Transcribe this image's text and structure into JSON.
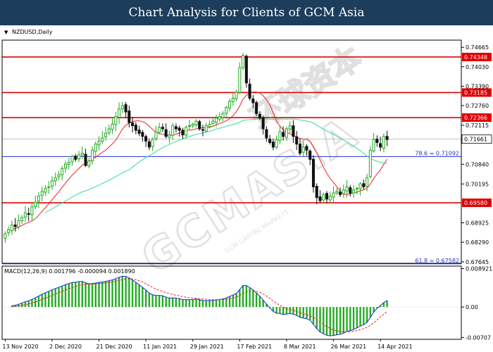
{
  "banner": {
    "title": "Chart Analysis for Clients of GCM Asia"
  },
  "chart_data": [
    {
      "type": "candlestick",
      "symbol_label": "NZDUSD,Daily",
      "watermark": {
        "text": "GCMASIA",
        "subtext": "GCM CAPITAL MARKETS",
        "chinese": "环球资本"
      },
      "ylim": [
        0.676,
        0.749
      ],
      "y_ticks": [
        "0.74665",
        "0.74030",
        "0.73390",
        "0.72760",
        "0.72115",
        "0.70840",
        "0.70195",
        "0.68925",
        "0.68290",
        "0.67645"
      ],
      "x_ticks": [
        "13 Nov 2020",
        "2 Dec 2020",
        "21 Dec 2020",
        "11 Jan 2021",
        "29 Jan 2021",
        "17 Feb 2021",
        "8 Mar 2021",
        "26 Mar 2021",
        "14 Apr 2021"
      ],
      "x_tick_bars": [
        0,
        14,
        28,
        42,
        56,
        70,
        84,
        98,
        112
      ],
      "horizontal_levels": [
        {
          "label": "0.74348",
          "value": 0.74348,
          "color": "#e00000"
        },
        {
          "label": "0.73185",
          "value": 0.73185,
          "color": "#e00000"
        },
        {
          "label": "0.72366",
          "value": 0.72366,
          "color": "#e00000"
        },
        {
          "label": "0.69580",
          "value": 0.6958,
          "color": "#e00000"
        },
        {
          "label": "78.6 = 0.71092",
          "value": 0.71092,
          "color": "#2233cc"
        },
        {
          "label": "61.8 = 0.67582",
          "value": 0.67582,
          "color": "#2233cc"
        }
      ],
      "current_price": {
        "label": "0.71661",
        "value": 0.71661
      },
      "colors": {
        "up": "#22aa22",
        "down": "#111111",
        "fast_ma": "#ee2222",
        "slow_ma": "#33dd99",
        "level": "#e00000",
        "fib": "#2233cc"
      },
      "close": [
        0.6857,
        0.687,
        0.6885,
        0.688,
        0.69,
        0.691,
        0.6925,
        0.692,
        0.6945,
        0.696,
        0.698,
        0.6995,
        0.7005,
        0.701,
        0.703,
        0.704,
        0.705,
        0.707,
        0.7085,
        0.709,
        0.711,
        0.71,
        0.7115,
        0.712,
        0.708,
        0.7095,
        0.713,
        0.715,
        0.716,
        0.717,
        0.7185,
        0.72,
        0.7215,
        0.724,
        0.7265,
        0.7275,
        0.7255,
        0.722,
        0.721,
        0.7195,
        0.7185,
        0.7175,
        0.716,
        0.714,
        0.7165,
        0.719,
        0.7205,
        0.72,
        0.7175,
        0.718,
        0.721,
        0.72,
        0.7195,
        0.718,
        0.7205,
        0.721,
        0.7215,
        0.7225,
        0.72,
        0.7195,
        0.721,
        0.7215,
        0.7225,
        0.7235,
        0.724,
        0.725,
        0.727,
        0.729,
        0.73,
        0.732,
        0.74,
        0.744,
        0.735,
        0.73,
        0.7285,
        0.725,
        0.7235,
        0.72,
        0.717,
        0.7155,
        0.714,
        0.7165,
        0.719,
        0.7175,
        0.72,
        0.721,
        0.7175,
        0.715,
        0.712,
        0.714,
        0.713,
        0.71,
        0.701,
        0.6975,
        0.6965,
        0.6985,
        0.697,
        0.698,
        0.699,
        0.6995,
        0.6985,
        0.7,
        0.701,
        0.699,
        0.7,
        0.7005,
        0.702,
        0.701,
        0.704,
        0.713,
        0.7165,
        0.7155,
        0.714,
        0.7175,
        0.7165
      ],
      "macd": {
        "label": "MACD(12,26,9) 0.001796 -0.000094 0.001890",
        "ylim": [
          -0.0075,
          0.0095
        ],
        "y_ticks": [
          "0.008921",
          "0.00",
          "-0.00707"
        ]
      }
    }
  ]
}
